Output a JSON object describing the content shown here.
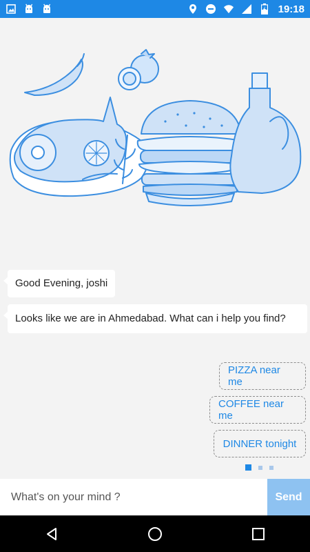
{
  "status_bar": {
    "time": "19:18",
    "icons_left": [
      "image-icon",
      "android-icon",
      "android-icon"
    ],
    "icons_right": [
      "location-icon",
      "do-not-disturb-icon",
      "wifi-icon",
      "signal-icon",
      "battery-charging-icon"
    ],
    "color": "#1e88e5"
  },
  "chat": {
    "greeting": "Good Evening, joshi",
    "message": "Looks like we are in Ahmedabad. What can i help you find?",
    "suggestions": [
      "PIZZA near me",
      "COFFEE near me",
      "DINNER tonight"
    ],
    "pager": {
      "pages": 3,
      "active": 0
    }
  },
  "input": {
    "placeholder": "What's on your mind ?",
    "send_label": "Send"
  },
  "navigation": {
    "buttons": [
      "back-icon",
      "home-icon",
      "recents-icon"
    ]
  },
  "colors": {
    "accent": "#1e88e5",
    "send_button": "#8ec2f1",
    "background": "#f3f3f3"
  }
}
